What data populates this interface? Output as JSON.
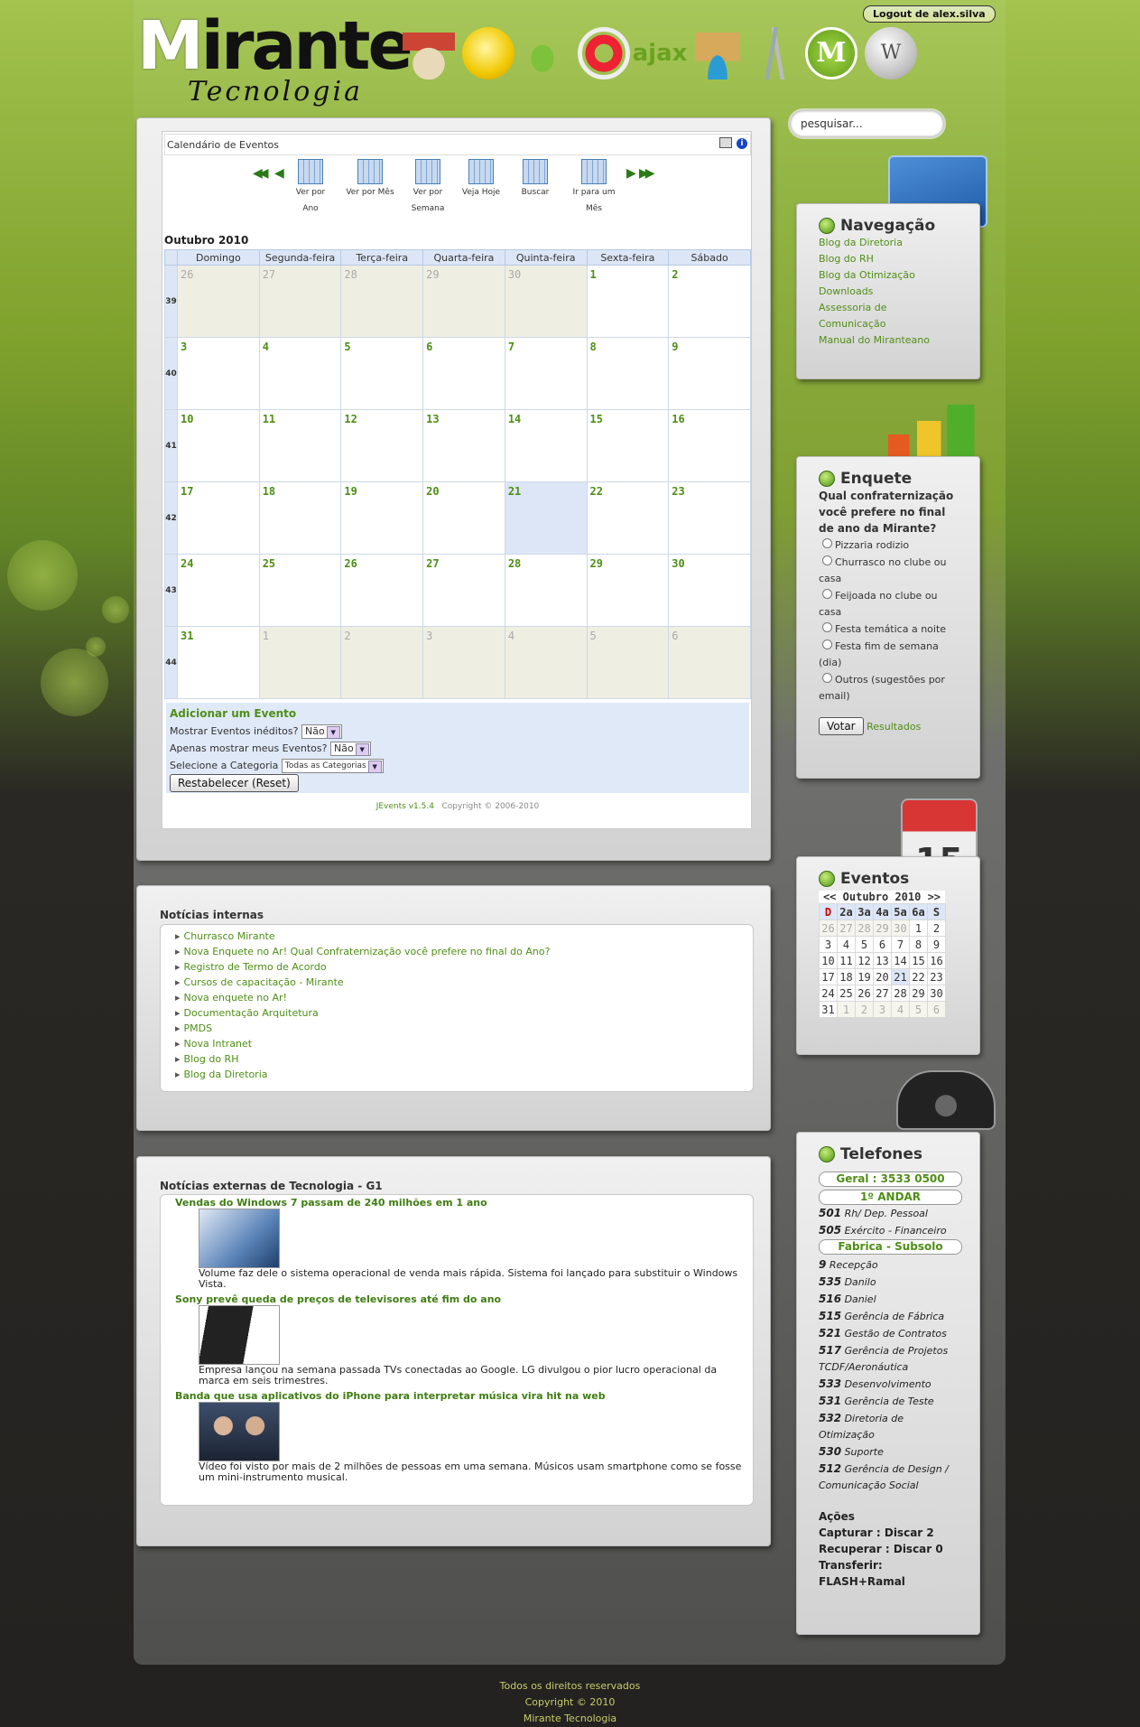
{
  "header": {
    "logo_word": "irante",
    "logo_m": "M",
    "logo_sub": "Tecnologia",
    "logout_label": "Logout de alex.silva",
    "icons": [
      "home-icon",
      "chat-icon",
      "mantis-bug-icon",
      "lifebuoy-icon",
      "ajax-pro-icon",
      "user-icon",
      "keys-icon",
      "mirante-m-icon",
      "wikipedia-icon"
    ],
    "search_placeholder": "pesquisar..."
  },
  "calendar": {
    "title": "Calendário de Eventos",
    "nav": [
      "Ver por Ano",
      "Ver por Mês",
      "Ver por Semana",
      "Veja Hoje",
      "Buscar",
      "Ir para um Mês"
    ],
    "month_title": "Outubro 2010",
    "weekdays": [
      "Domingo",
      "Segunda-feira",
      "Terça-feira",
      "Quarta-feira",
      "Quinta-feira",
      "Sexta-feira",
      "Sábado"
    ],
    "weeks": [
      {
        "num": "39",
        "days": [
          "26",
          "27",
          "28",
          "29",
          "30",
          "1",
          "2"
        ]
      },
      {
        "num": "40",
        "days": [
          "3",
          "4",
          "5",
          "6",
          "7",
          "8",
          "9"
        ]
      },
      {
        "num": "41",
        "days": [
          "10",
          "11",
          "12",
          "13",
          "14",
          "15",
          "16"
        ]
      },
      {
        "num": "42",
        "days": [
          "17",
          "18",
          "19",
          "20",
          "21",
          "22",
          "23"
        ]
      },
      {
        "num": "43",
        "days": [
          "24",
          "25",
          "26",
          "27",
          "28",
          "29",
          "30"
        ]
      },
      {
        "num": "44",
        "days": [
          "31",
          "1",
          "2",
          "3",
          "4",
          "5",
          "6"
        ]
      }
    ],
    "add_event": "Adicionar um Evento",
    "filter1_label": "Mostrar Eventos inéditos?",
    "filter1_value": "Não",
    "filter2_label": "Apenas mostrar meus Eventos?",
    "filter2_value": "Não",
    "filter3_label": "Selecione a Categoria",
    "filter3_value": "Todas as Categorias",
    "reset_label": "Restabelecer (Reset)",
    "credit": "JEvents v1.5.4",
    "copyright": "Copyright © 2006-2010"
  },
  "internal": {
    "title": "Notícias internas",
    "items": [
      "Churrasco Mirante",
      "Nova Enquete no Ar! Qual Confraternização você prefere no final do Ano?",
      "Registro de Termo de Acordo",
      "Cursos de capacitação - Mirante",
      "Nova enquete no Ar!",
      "Documentação Arquitetura",
      "PMDS",
      "Nova Intranet",
      "Blog do RH",
      "Blog da Diretoria"
    ]
  },
  "external": {
    "title": "Notícias externas de Tecnologia - G1",
    "items": [
      {
        "headline": "Vendas do Windows 7 passam de 240 milhões em 1 ano",
        "summary": "Volume faz dele o sistema operacional de venda mais rápida. Sistema foi lançado para substituir o Windows Vista."
      },
      {
        "headline": "Sony prevê queda de preços de televisores até fim do ano",
        "summary": "Empresa lançou na semana passada TVs conectadas ao Google. LG divulgou o pior lucro operacional da marca em seis trimestres."
      },
      {
        "headline": "Banda que usa aplicativos do iPhone para interpretar música vira hit na web",
        "summary": "Vídeo foi visto por mais de 2 milhões de pessoas em uma semana. Músicos usam smartphone como se fosse um mini-instrumento musical."
      }
    ]
  },
  "nav": {
    "title": "Navegação",
    "items": [
      "Blog da Diretoria",
      "Blog do RH",
      "Blog da Otimização",
      "Downloads",
      "Assessoria de Comunicação",
      "Manual do Miranteano"
    ]
  },
  "poll": {
    "title": "Enquete",
    "question": "Qual confraternização você prefere no final de ano da Mirante?",
    "options": [
      "Pizzaria rodizio",
      "Churrasco no clube ou casa",
      "Feijoada no clube ou casa",
      "Festa temática a noite",
      "Festa fim de semana (dia)",
      "Outros (sugestões por email)"
    ],
    "vote_label": "Votar",
    "results_label": "Resultados"
  },
  "events": {
    "title": "Eventos",
    "prev": "<<",
    "next": ">>",
    "month": "Outubro 2010",
    "days": [
      "D",
      "2a",
      "3a",
      "4a",
      "5a",
      "6a",
      "S"
    ],
    "rows": [
      [
        "26",
        "27",
        "28",
        "29",
        "30",
        "1",
        "2"
      ],
      [
        "3",
        "4",
        "5",
        "6",
        "7",
        "8",
        "9"
      ],
      [
        "10",
        "11",
        "12",
        "13",
        "14",
        "15",
        "16"
      ],
      [
        "17",
        "18",
        "19",
        "20",
        "21",
        "22",
        "23"
      ],
      [
        "24",
        "25",
        "26",
        "27",
        "28",
        "29",
        "30"
      ],
      [
        "31",
        "1",
        "2",
        "3",
        "4",
        "5",
        "6"
      ]
    ]
  },
  "phones": {
    "title": "Telefones",
    "general": "Geral : 3533 0500",
    "floor1": "1º ANDAR",
    "floor1_list": [
      {
        "ext": "501",
        "name": "Rh/ Dep. Pessoal"
      },
      {
        "ext": "505",
        "name": "Exército - Financeiro"
      }
    ],
    "basement": "Fabrica - Subsolo",
    "basement_list": [
      {
        "ext": "9",
        "name": "Recepção"
      },
      {
        "ext": "535",
        "name": "Danilo"
      },
      {
        "ext": "516",
        "name": "Daniel"
      },
      {
        "ext": "515",
        "name": "Gerência de Fábrica"
      },
      {
        "ext": "521",
        "name": "Gestão de Contratos"
      },
      {
        "ext": "517",
        "name": "Gerência de Projetos TCDF/Aeronáutica"
      },
      {
        "ext": "533",
        "name": "Desenvolvimento"
      },
      {
        "ext": "531",
        "name": "Gerência de Teste"
      },
      {
        "ext": "532",
        "name": "Diretoria de Otimização"
      },
      {
        "ext": "530",
        "name": "Suporte"
      },
      {
        "ext": "512",
        "name": "Gerência de Design / Comunicação Social"
      }
    ],
    "actions_title": "Ações",
    "action1": "Capturar : Discar 2",
    "action2": "Recuperar : Discar 0",
    "action3": "Transferir: FLASH+Ramal"
  },
  "footer": {
    "line1": "Todos os direitos reservados",
    "line2": "Copyright © 2010",
    "line3": "Mirante Tecnologia"
  }
}
